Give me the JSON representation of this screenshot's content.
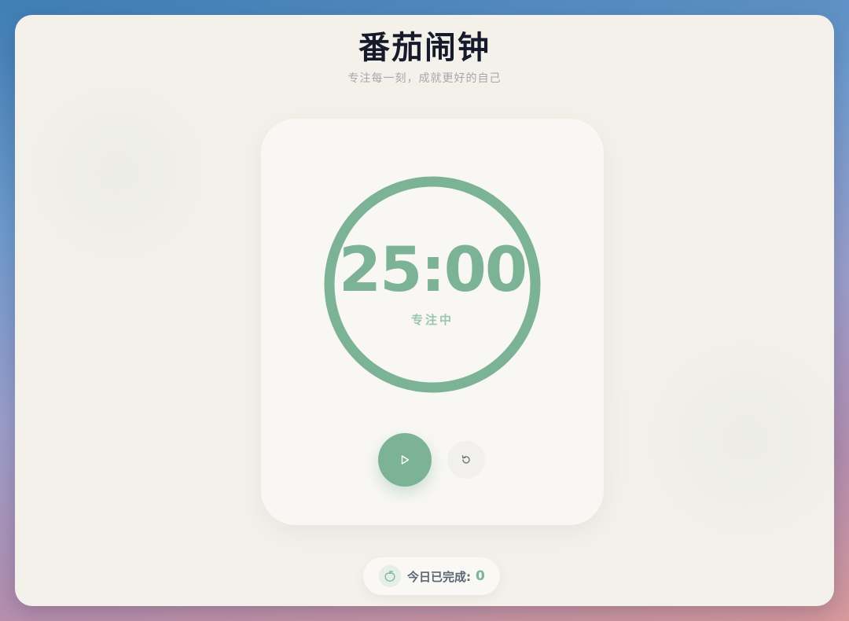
{
  "header": {
    "title": "番茄闹钟",
    "subtitle": "专注每一刻，成就更好的自己"
  },
  "timer": {
    "time": "25:00",
    "mode": "专注中",
    "progress": 1.0
  },
  "controls": {
    "play_icon": "play-icon",
    "reset_icon": "reset-icon"
  },
  "stats": {
    "icon": "tomato-icon",
    "label": "今日已完成:",
    "count": "0"
  },
  "colors": {
    "accent": "#7cb397",
    "accent_light": "#9cc5ae",
    "background": "#f4f1eb",
    "card": "#f8f7f3",
    "title": "#171a2b"
  }
}
